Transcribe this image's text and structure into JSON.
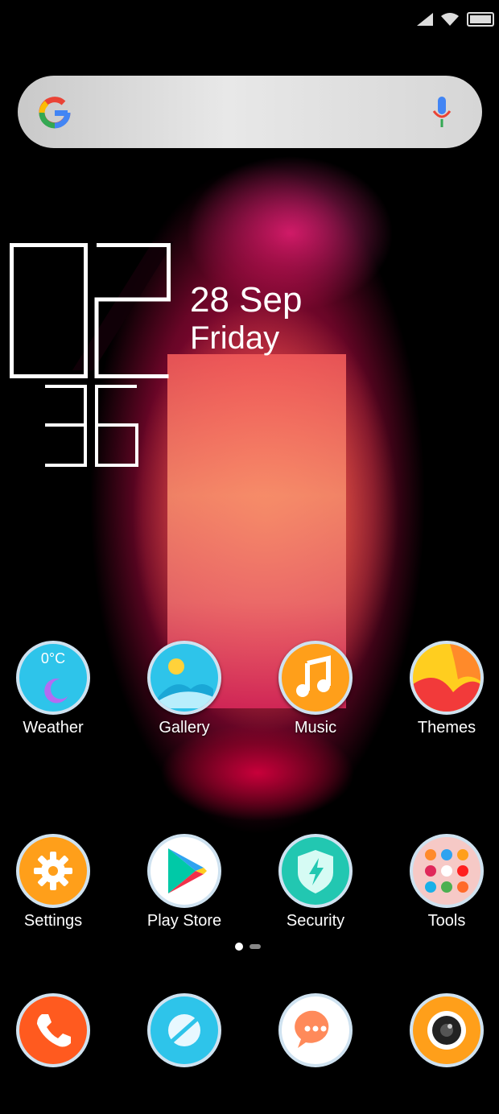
{
  "clock": {
    "date": "28 Sep",
    "day": "Friday",
    "hour": "02",
    "minute": "36"
  },
  "weather": {
    "temp": "0°C"
  },
  "apps": [
    {
      "label": "Weather",
      "icon": "weather-icon"
    },
    {
      "label": "Gallery",
      "icon": "gallery-icon"
    },
    {
      "label": "Music",
      "icon": "music-icon"
    },
    {
      "label": "Themes",
      "icon": "themes-icon"
    },
    {
      "label": "Settings",
      "icon": "gear-icon"
    },
    {
      "label": "Play Store",
      "icon": "play-store-icon"
    },
    {
      "label": "Security",
      "icon": "shield-icon"
    },
    {
      "label": "Tools",
      "icon": "folder-icon"
    }
  ],
  "dock": [
    {
      "icon": "phone-icon"
    },
    {
      "icon": "browser-icon"
    },
    {
      "icon": "messaging-icon"
    },
    {
      "icon": "camera-icon"
    }
  ],
  "page_indicator": {
    "pages": 2,
    "current": 1
  },
  "colors": {
    "search_bar": "#e0e0e0",
    "weather": "#2ec4ea",
    "music": "#ff9f1a",
    "settings": "#ff9f1a",
    "security": "#22c7b1",
    "phone": "#ff5a1f"
  }
}
